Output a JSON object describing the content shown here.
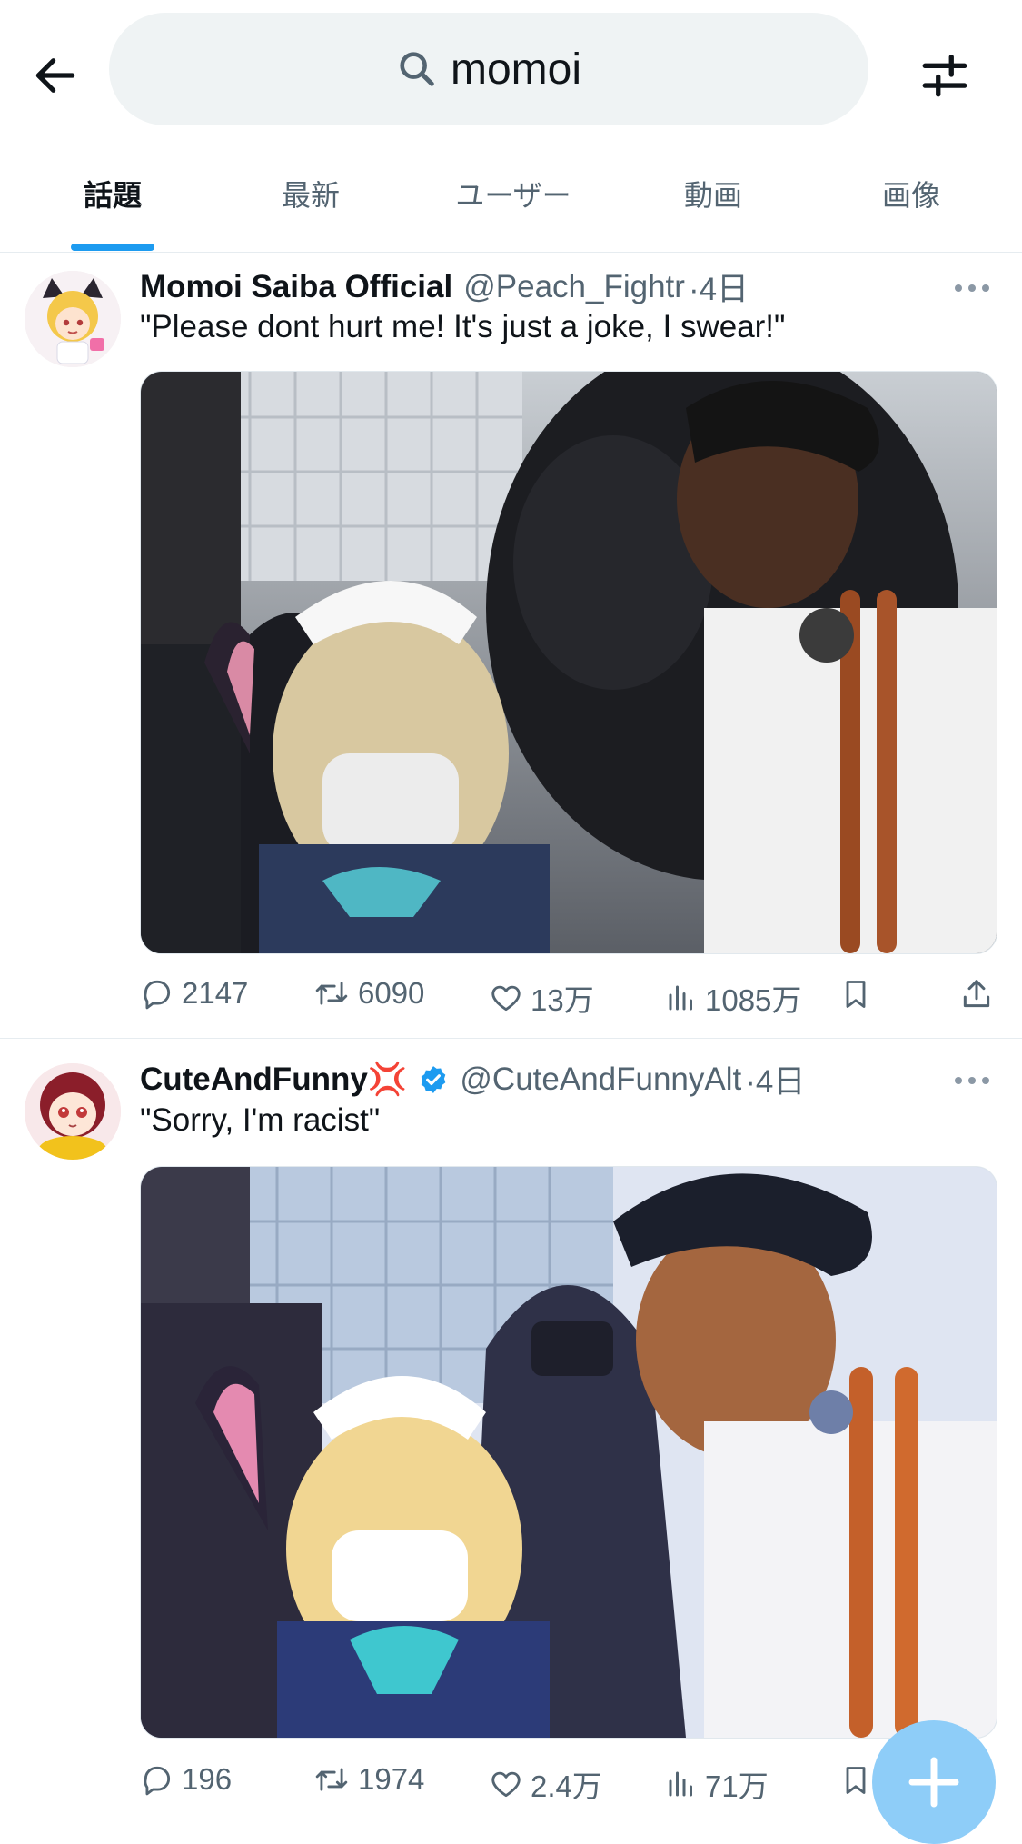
{
  "search": {
    "query": "momoi"
  },
  "tabs": [
    {
      "label": "話題",
      "active": true
    },
    {
      "label": "最新"
    },
    {
      "label": "ユーザー"
    },
    {
      "label": "動画"
    },
    {
      "label": "画像"
    }
  ],
  "posts": [
    {
      "display_name": "Momoi Saiba Official",
      "handle": "@Peach_Fightr",
      "time": "·4日",
      "text": "\"Please dont hurt me! It's just a joke, I swear!\"",
      "verified": false,
      "stats": {
        "replies": "2147",
        "reposts": "6090",
        "likes": "13万",
        "views": "1085万"
      }
    },
    {
      "display_name": "CuteAndFunny",
      "emoji": "💢",
      "handle": "@CuteAndFunnyAlt",
      "time": "·4日",
      "text": "\"Sorry, I'm racist\"",
      "verified": true,
      "stats": {
        "replies": "196",
        "reposts": "1974",
        "likes": "2.4万",
        "views": "71万"
      }
    }
  ],
  "colors": {
    "accent": "#1d9bf0",
    "secondary_text": "#536471",
    "fab": "#8ecdf8",
    "search_bg": "#eff3f4"
  },
  "icons": [
    "back-arrow-icon",
    "search-icon",
    "filter-icon",
    "more-icon",
    "reply-icon",
    "repost-icon",
    "like-icon",
    "views-icon",
    "bookmark-icon",
    "share-icon",
    "verified-badge-icon",
    "compose-icon"
  ]
}
